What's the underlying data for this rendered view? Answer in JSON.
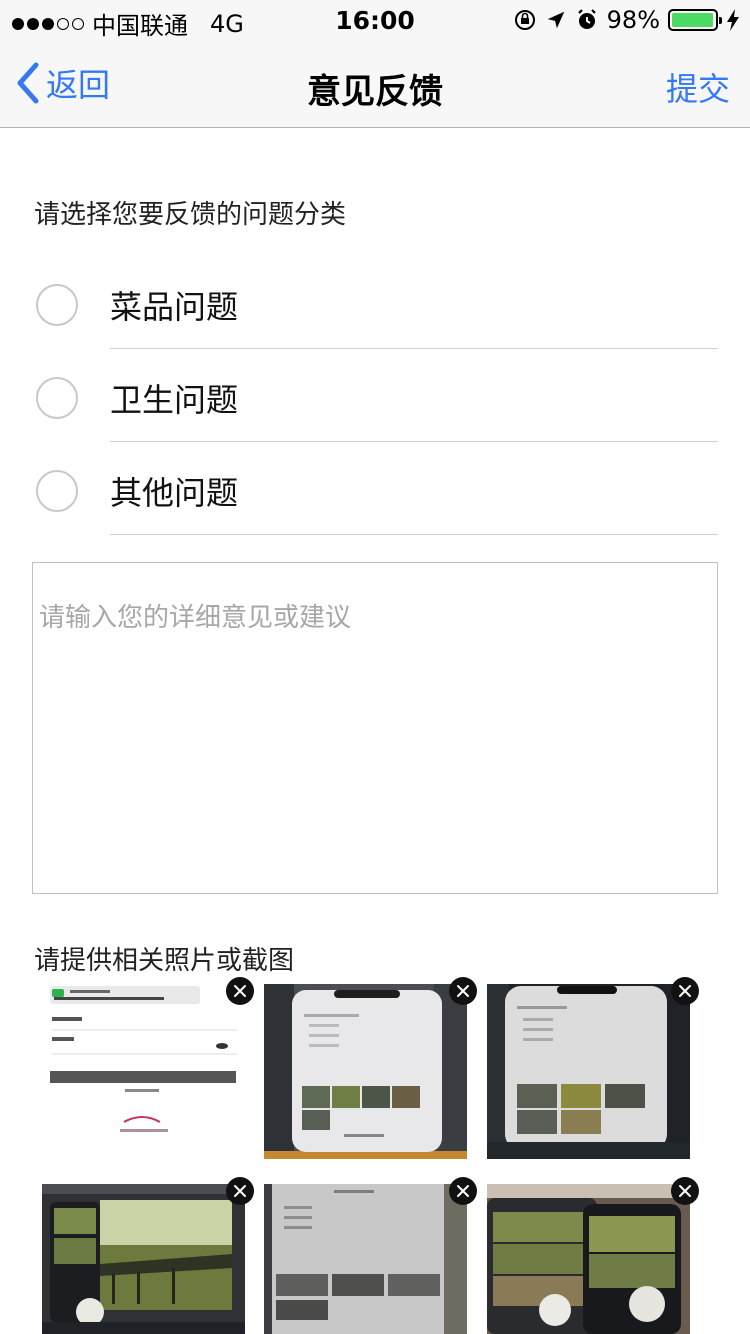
{
  "status_bar": {
    "carrier": "中国联通",
    "network": "4G",
    "time": "16:00",
    "battery": "98%",
    "battery_level": 0.98,
    "battery_color": "#4cd964"
  },
  "nav": {
    "back_label": "返回",
    "title": "意见反馈",
    "submit_label": "提交",
    "accent_color": "#3478f6"
  },
  "category": {
    "prompt": "请选择您要反馈的问题分类",
    "options": [
      {
        "label": "菜品问题",
        "selected": false
      },
      {
        "label": "卫生问题",
        "selected": false
      },
      {
        "label": "其他问题",
        "selected": false
      }
    ]
  },
  "feedback": {
    "placeholder": "请输入您的详细意见或建议",
    "value": ""
  },
  "photos": {
    "prompt": "请提供相关照片或截图",
    "items": [
      {
        "name": "photo-wechat-login-screenshot"
      },
      {
        "name": "photo-phone-feedback-screen"
      },
      {
        "name": "photo-phone-feedback-screen-2"
      },
      {
        "name": "photo-monitor-pier-image"
      },
      {
        "name": "photo-feedback-form-gray"
      },
      {
        "name": "photo-phones-pier-image"
      }
    ]
  }
}
